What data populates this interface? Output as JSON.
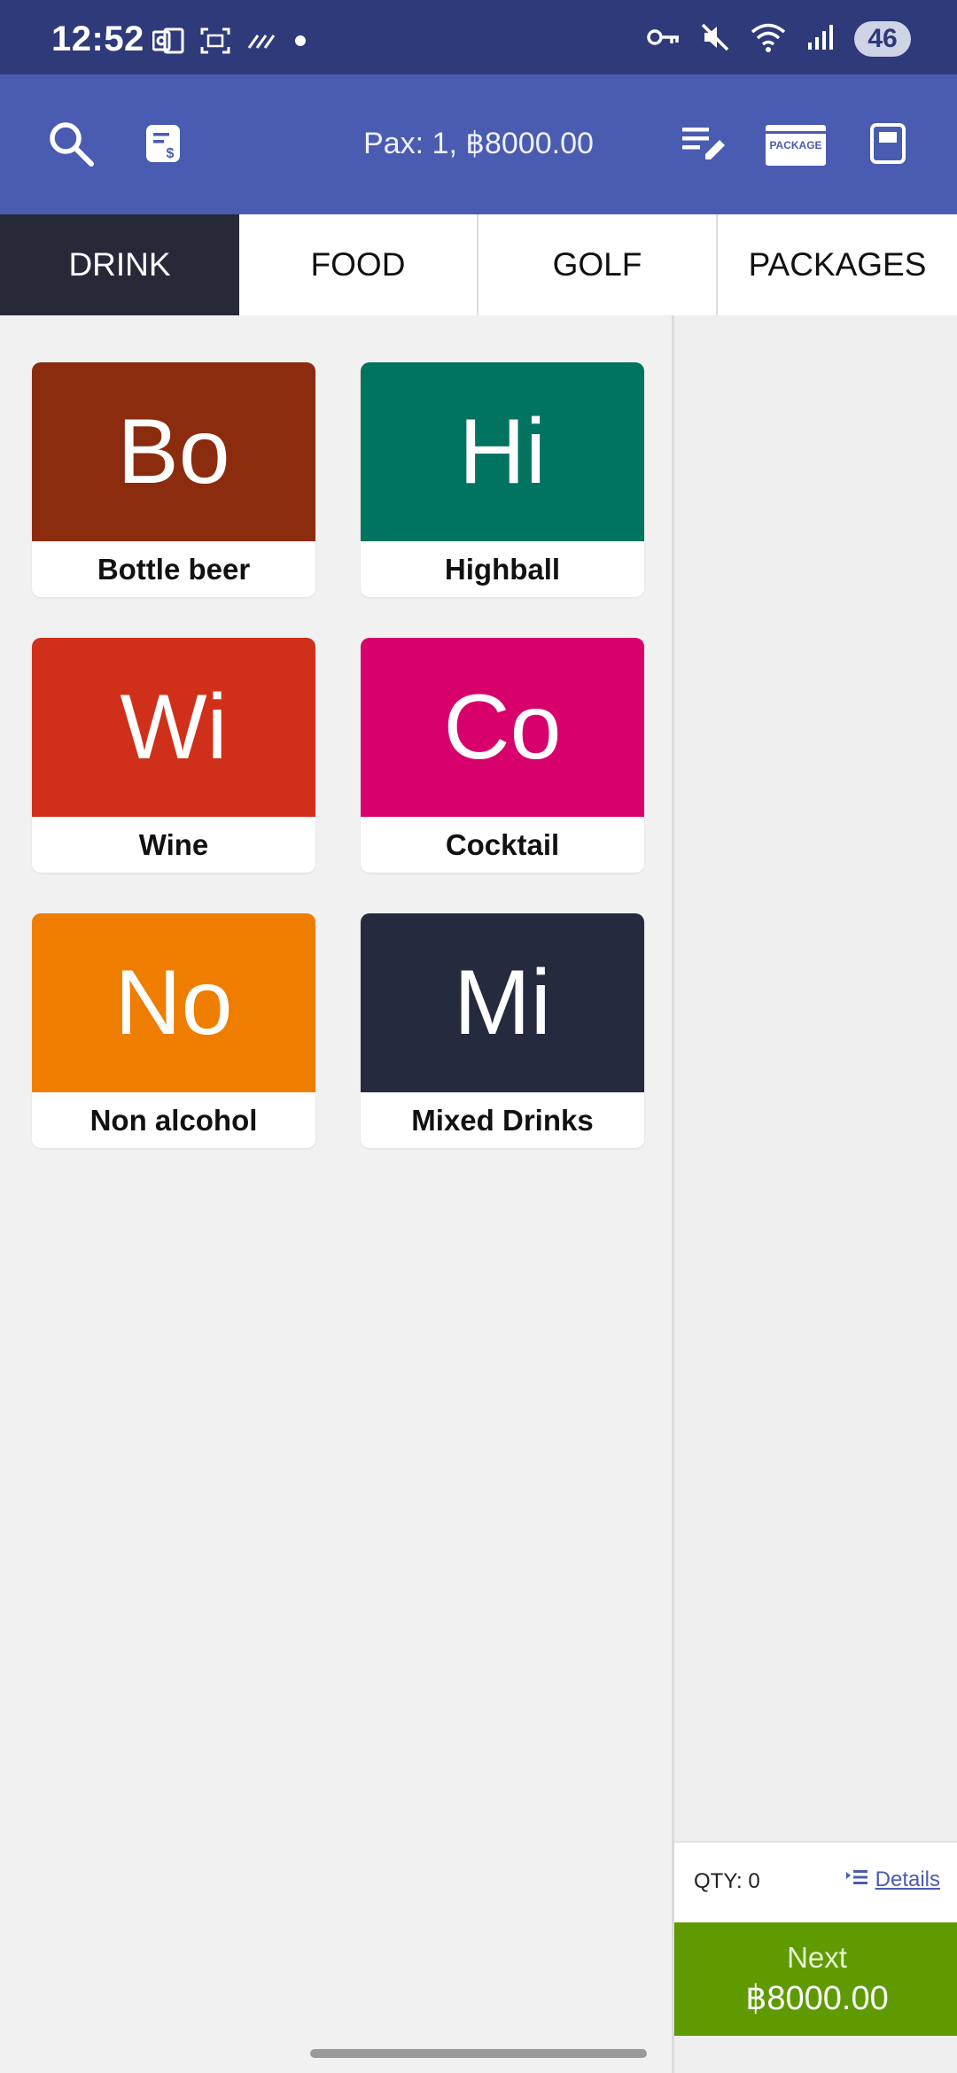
{
  "status_bar": {
    "time": "12:52",
    "battery": "46",
    "left_icons": [
      "outlook-icon",
      "screenshot-icon",
      "data-saver-icon",
      "dot-icon"
    ],
    "right_icons": [
      "vpn-key-icon",
      "mute-icon",
      "wifi-icon",
      "signal-icon"
    ]
  },
  "app_bar": {
    "pax_text": "Pax: 1, ฿8000.00",
    "package_label": "PACKAGE",
    "background": "#4a5cb1"
  },
  "tabs": [
    {
      "label": "DRINK",
      "active": true
    },
    {
      "label": "FOOD",
      "active": false
    },
    {
      "label": "GOLF",
      "active": false
    },
    {
      "label": "PACKAGES",
      "active": false
    }
  ],
  "categories": [
    {
      "abbr": "Bo",
      "label": "Bottle beer",
      "color": "#8b2c0e"
    },
    {
      "abbr": "Hi",
      "label": "Highball",
      "color": "#007361"
    },
    {
      "abbr": "Wi",
      "label": "Wine",
      "color": "#d0301a"
    },
    {
      "abbr": "Co",
      "label": "Cocktail",
      "color": "#d8006b"
    },
    {
      "abbr": "No",
      "label": "Non alcohol",
      "color": "#ef7e00"
    },
    {
      "abbr": "Mi",
      "label": "Mixed Drinks",
      "color": "#262a3f"
    }
  ],
  "order_panel": {
    "qty_text": "QTY: 0",
    "details_label": "Details",
    "next_label": "Next",
    "next_amount": "฿8000.00",
    "next_color": "#5f9a00"
  }
}
